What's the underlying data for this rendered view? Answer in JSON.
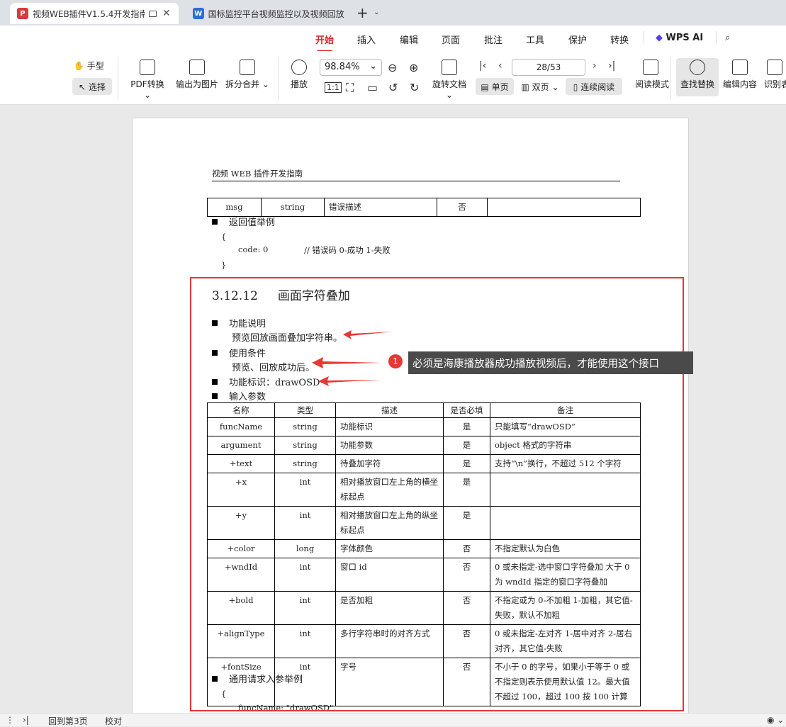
{
  "browser": {
    "tabs": [
      {
        "label": "视频WEB插件V1.5.4开发指南",
        "icon": "pdf-icon",
        "color": "#d23c3c"
      },
      {
        "label": "国标监控平台视频监控以及视频回放",
        "icon": "word-icon",
        "color": "#2b6fd6"
      }
    ]
  },
  "ribbon": {
    "tabs": [
      "开始",
      "插入",
      "编辑",
      "页面",
      "批注",
      "工具",
      "保护",
      "转换",
      "WPS AI"
    ],
    "active_tab": "开始"
  },
  "toolbar": {
    "hand": "手型",
    "select": "选择",
    "pdf_convert": "PDF转换",
    "export_image": "输出为图片",
    "split_merge": "拆分合并",
    "play": "播放",
    "zoom": "98.84%",
    "rotate": "旋转文档",
    "page_value": "28/53",
    "single": "单页",
    "double": "双页",
    "continuous": "连续阅读",
    "read_mode": "阅读模式",
    "find_replace": "查找替换",
    "edit_content": "编辑内容",
    "recognize": "识别表"
  },
  "document": {
    "header": "视频 WEB 插件开发指南",
    "top_row": [
      "msg",
      "string",
      "错误描述",
      "否",
      ""
    ],
    "return_example": "返回值举例",
    "code_open": "{",
    "code_line": "code: 0",
    "code_comment": "// 错误码 0-成功  1-失败",
    "code_close": "}",
    "section_number": "3.12.12",
    "section_title": "画面字符叠加",
    "func_desc_label": "功能说明",
    "func_desc": "预览回放画面叠加字符串。",
    "condition_label": "使用条件",
    "condition": "预览、回放成功后。",
    "func_id": "功能标识：drawOSD",
    "input_params": "输入参数",
    "param_headers": [
      "名称",
      "类型",
      "描述",
      "是否必填",
      "备注"
    ],
    "params": [
      [
        "funcName",
        "string",
        "功能标识",
        "是",
        "只能填写“drawOSD”"
      ],
      [
        "argument",
        "string",
        "功能参数",
        "是",
        "object 格式的字符串"
      ],
      [
        "+text",
        "string",
        "待叠加字符",
        "是",
        "支持“\\n”换行，不超过 512 个字符"
      ],
      [
        "+x",
        "int",
        "相对播放窗口左上角的横坐标起点",
        "是",
        ""
      ],
      [
        "+y",
        "int",
        "相对播放窗口左上角的纵坐标起点",
        "是",
        ""
      ],
      [
        "+color",
        "long",
        "字体颜色",
        "否",
        "不指定默认为白色"
      ],
      [
        "+wndId",
        "int",
        "窗口 id",
        "否",
        "0 或未指定-选中窗口字符叠加  大于 0 为 wndId 指定的窗口字符叠加"
      ],
      [
        "+bold",
        "int",
        "是否加粗",
        "否",
        "不指定或为 0-不加粗  1-加粗，其它值-失败，默认不加粗"
      ],
      [
        "+alignType",
        "int",
        "多行字符串时的对齐方式",
        "否",
        "0 或未指定-左对齐 1-居中对齐  2-居右对齐，其它值-失败"
      ],
      [
        "+fontSize",
        "int",
        "字号",
        "否",
        "不小于 0 的字号，如果小于等于 0 或不指定则表示使用默认值 12。最大值不超过 100，超过 100 按 100 计算"
      ]
    ],
    "request_example": "通用请求入参举例",
    "req_open": "{",
    "req_line": "funcName: \"drawOSD\","
  },
  "annotation": {
    "badge": "1",
    "callout": "必须是海康播放器成功播放视频后，才能使用这个接口"
  },
  "statusbar": {
    "goto": "回到第3页",
    "proof": "校对"
  }
}
